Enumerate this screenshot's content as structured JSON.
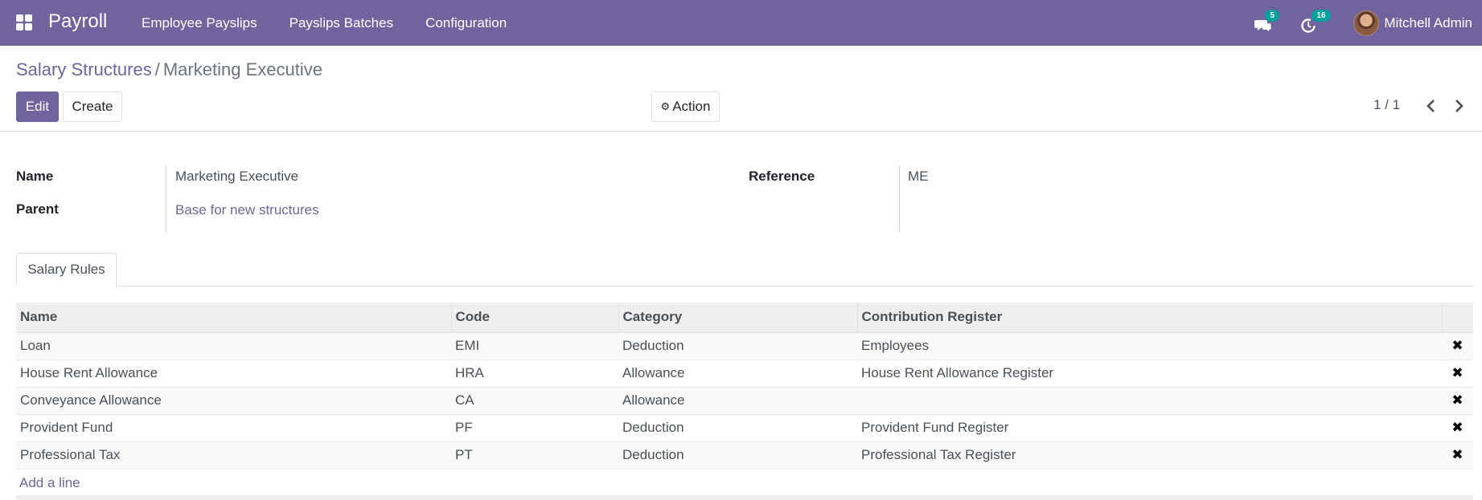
{
  "navbar": {
    "brand": "Payroll",
    "menu": [
      "Employee Payslips",
      "Payslips Batches",
      "Configuration"
    ],
    "messages_count": "5",
    "activities_count": "16",
    "user_name": "Mitchell Admin",
    "color": "#71639e"
  },
  "breadcrumb": {
    "parent": "Salary Structures",
    "separator": "/",
    "current": "Marketing Executive"
  },
  "buttons": {
    "edit": "Edit",
    "create": "Create",
    "action": "Action"
  },
  "pager": {
    "value": "1 / 1"
  },
  "form": {
    "name_label": "Name",
    "name_value": "Marketing Executive",
    "parent_label": "Parent",
    "parent_value": "Base for new structures",
    "reference_label": "Reference",
    "reference_value": "ME"
  },
  "tabs": [
    "Salary Rules"
  ],
  "table": {
    "columns": [
      "Name",
      "Code",
      "Category",
      "Contribution Register"
    ],
    "rows": [
      {
        "name": "Loan",
        "code": "EMI",
        "category": "Deduction",
        "register": "Employees"
      },
      {
        "name": "House Rent Allowance",
        "code": "HRA",
        "category": "Allowance",
        "register": "House Rent Allowance Register"
      },
      {
        "name": "Conveyance Allowance",
        "code": "CA",
        "category": "Allowance",
        "register": ""
      },
      {
        "name": "Provident Fund",
        "code": "PF",
        "category": "Deduction",
        "register": "Provident Fund Register"
      },
      {
        "name": "Professional Tax",
        "code": "PT",
        "category": "Deduction",
        "register": "Professional Tax Register"
      }
    ],
    "add_line": "Add a line"
  },
  "icons": {
    "apps": "apps-grid-icon",
    "messages": "chat-icon",
    "activities": "clock-icon",
    "gear": "gear-icon",
    "prev": "chevron-left-icon",
    "next": "chevron-right-icon",
    "delete": "close-icon"
  }
}
